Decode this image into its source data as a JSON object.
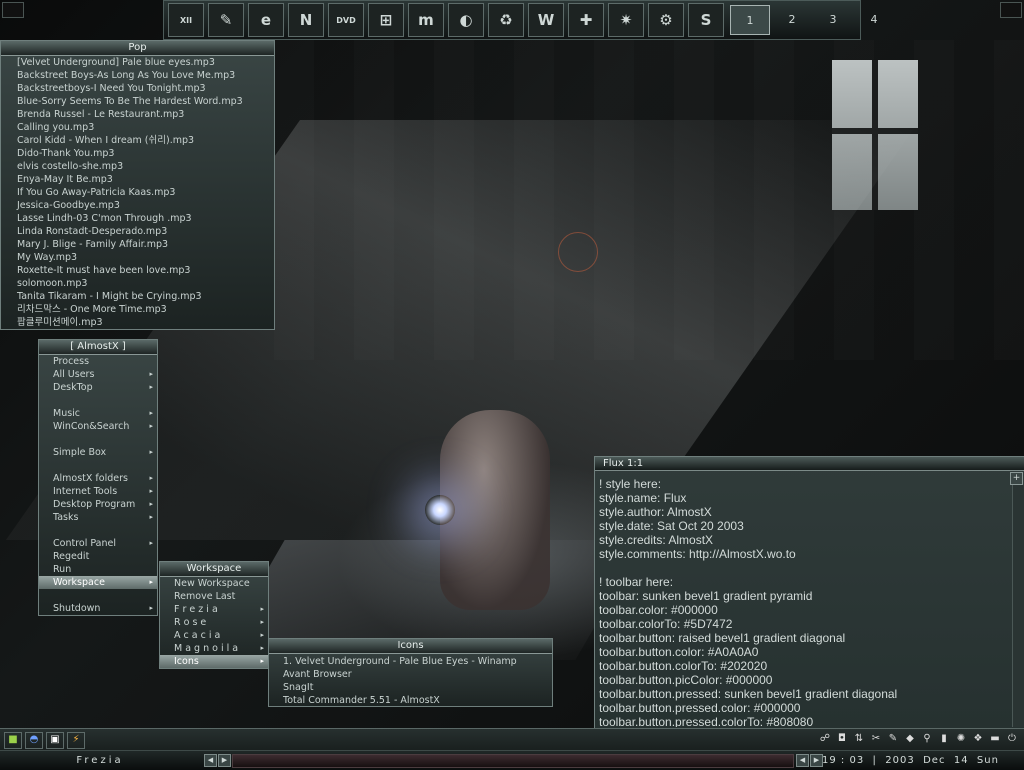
{
  "dock": {
    "icons": [
      {
        "name": "clock-icon",
        "glyph": "XII"
      },
      {
        "name": "notepad-icon",
        "glyph": "✎"
      },
      {
        "name": "internet-explorer-icon",
        "glyph": "e"
      },
      {
        "name": "netscape-icon",
        "glyph": "N"
      },
      {
        "name": "dvd-player-icon",
        "glyph": "DVD"
      },
      {
        "name": "windows-icon",
        "glyph": "⊞"
      },
      {
        "name": "media-player-icon",
        "glyph": "m"
      },
      {
        "name": "winamp-icon",
        "glyph": "◐"
      },
      {
        "name": "recycle-icon",
        "glyph": "♻"
      },
      {
        "name": "web-icon",
        "glyph": "W"
      },
      {
        "name": "first-aid-icon",
        "glyph": "✚"
      },
      {
        "name": "spider-icon",
        "glyph": "✷"
      },
      {
        "name": "settings-gear-icon",
        "glyph": "⚙"
      },
      {
        "name": "swirl-icon",
        "glyph": "S"
      }
    ],
    "workspaces": [
      "1",
      "2",
      "3",
      "4"
    ]
  },
  "pop": {
    "title": "Pop",
    "items": [
      "[Velvet Underground] Pale blue eyes.mp3",
      "Backstreet Boys-As Long As You Love Me.mp3",
      "Backstreetboys-I Need You Tonight.mp3",
      "Blue-Sorry Seems To Be The Hardest Word.mp3",
      "Brenda Russel - Le Restaurant.mp3",
      "Calling you.mp3",
      "Carol Kidd - When I dream (쉬리).mp3",
      "Dido-Thank You.mp3",
      "elvis costello-she.mp3",
      "Enya-May It Be.mp3",
      "If You Go Away-Patricia Kaas.mp3",
      "Jessica-Goodbye.mp3",
      "Lasse Lindh-03 C'mon Through .mp3",
      "Linda Ronstadt-Desperado.mp3",
      "Mary J. Blige - Family Affair.mp3",
      "My Way.mp3",
      "Roxette-It must have been love.mp3",
      "solomoon.mp3",
      "Tanita Tikaram - I Might be Crying.mp3",
      "리차드막스 - One More Time.mp3",
      "팝클루미션메이.mp3"
    ]
  },
  "almostx": {
    "title": "[ AlmostX ]",
    "items": [
      {
        "label": "Process",
        "sub": false
      },
      {
        "label": "All Users",
        "sub": true
      },
      {
        "label": "DeskTop",
        "sub": true
      },
      {
        "label": "",
        "sub": false
      },
      {
        "label": "Music",
        "sub": true
      },
      {
        "label": "WinCon&Search",
        "sub": true
      },
      {
        "label": "",
        "sub": false
      },
      {
        "label": "Simple Box",
        "sub": true
      },
      {
        "label": "",
        "sub": false
      },
      {
        "label": "AlmostX folders",
        "sub": true
      },
      {
        "label": "Internet Tools",
        "sub": true
      },
      {
        "label": "Desktop Program",
        "sub": true
      },
      {
        "label": "Tasks",
        "sub": true
      },
      {
        "label": "",
        "sub": false
      },
      {
        "label": "Control Panel",
        "sub": true
      },
      {
        "label": "Regedit",
        "sub": false
      },
      {
        "label": "Run",
        "sub": false
      },
      {
        "label": "Workspace",
        "sub": true,
        "selected": true
      },
      {
        "label": "",
        "sub": false
      },
      {
        "label": "Shutdown",
        "sub": true
      }
    ]
  },
  "workspace": {
    "title": "Workspace",
    "items": [
      {
        "label": "New Workspace",
        "sub": false
      },
      {
        "label": "Remove Last",
        "sub": false
      },
      {
        "label": "F r e z i a",
        "sub": true
      },
      {
        "label": "R o s e",
        "sub": true
      },
      {
        "label": "A c a c i a",
        "sub": true
      },
      {
        "label": "M a g n o i l a",
        "sub": true
      },
      {
        "label": "Icons",
        "sub": true,
        "selected": true
      }
    ]
  },
  "icons_menu": {
    "title": "Icons",
    "items": [
      "1. Velvet Underground - Pale Blue Eyes - Winamp",
      "Avant Browser",
      "SnagIt",
      "Total Commander 5.51 - AlmostX"
    ]
  },
  "flux": {
    "title": "Flux  1:1",
    "lines": [
      "! style here:",
      "style.name: Flux",
      "style.author: AlmostX",
      "style.date: Sat Oct 20 2003",
      "style.credits: AlmostX",
      "style.comments: http://AlmostX.wo.to",
      "",
      "! toolbar here:",
      "toolbar: sunken bevel1 gradient pyramid",
      "toolbar.color: #000000",
      "toolbar.colorTo: #5D7472",
      "toolbar.button: raised bevel1 gradient diagonal",
      "toolbar.button.color: #A0A0A0",
      "toolbar.button.colorTo: #202020",
      "toolbar.button.picColor: #000000",
      "toolbar.button.pressed: sunken bevel1 gradient diagonal",
      "toolbar.button.pressed.color: #000000",
      "toolbar.button.pressed.colorTo: #808080"
    ]
  },
  "taskbar": {
    "workspace_name": "Frezia",
    "clock": {
      "hour": "19",
      "minute": "03",
      "year": "2003",
      "month": "Dec",
      "day": "14",
      "weekday": "Sun"
    },
    "left_icons": [
      {
        "name": "desktop-icon",
        "glyph": "■",
        "color": "#9bd14a"
      },
      {
        "name": "browser-icon",
        "glyph": "◓",
        "color": "#6fa0ff"
      },
      {
        "name": "save-icon",
        "glyph": "▣",
        "color": "#ffffff"
      },
      {
        "name": "lightning-icon",
        "glyph": "⚡",
        "color": "#ffb640"
      }
    ],
    "tray_icons": [
      {
        "name": "network-icon",
        "glyph": "☍"
      },
      {
        "name": "shield-icon",
        "glyph": "◘"
      },
      {
        "name": "arrows-icon",
        "glyph": "⇅"
      },
      {
        "name": "tool-icon",
        "glyph": "✂"
      },
      {
        "name": "pen-icon",
        "glyph": "✎"
      },
      {
        "name": "ticket-icon",
        "glyph": "◆"
      },
      {
        "name": "pin-icon",
        "glyph": "⚲"
      },
      {
        "name": "battery-icon",
        "glyph": "▮"
      },
      {
        "name": "sun-icon",
        "glyph": "✺"
      },
      {
        "name": "chat-icon",
        "glyph": "❖"
      },
      {
        "name": "folder-icon",
        "glyph": "▬"
      },
      {
        "name": "power-icon",
        "glyph": "⏻"
      }
    ]
  }
}
